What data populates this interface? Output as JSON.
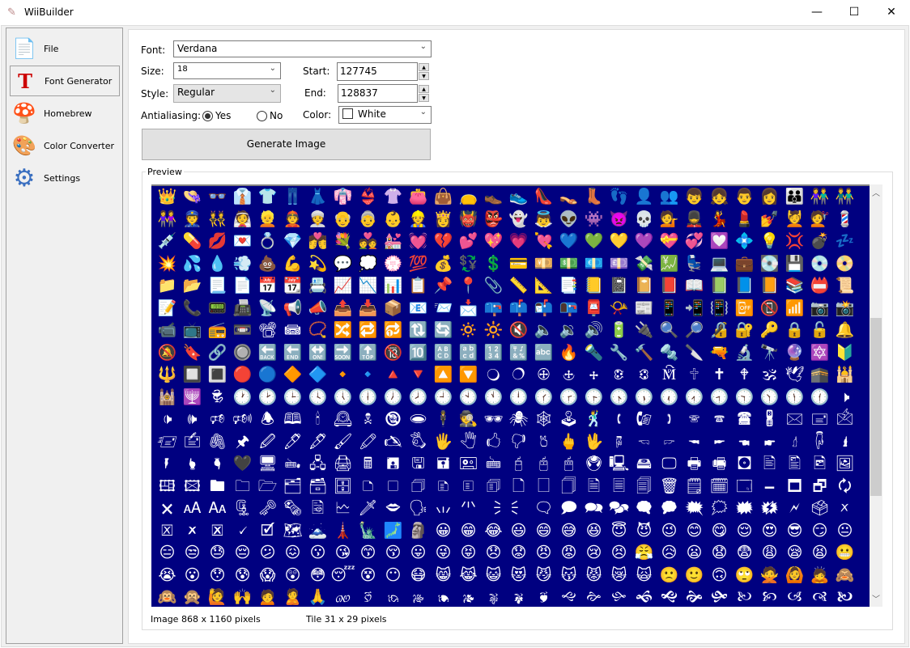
{
  "window": {
    "title": "WiiBuilder",
    "minimize": "—",
    "maximize": "☐",
    "close": "✕"
  },
  "sidebar": {
    "items": [
      {
        "label": "File",
        "icon": "📄"
      },
      {
        "label": "Font Generator",
        "icon": "T",
        "active": true
      },
      {
        "label": "Homebrew",
        "icon": "🍄"
      },
      {
        "label": "Color Converter",
        "icon": "🎨"
      },
      {
        "label": "Settings",
        "icon": "⚙"
      }
    ]
  },
  "form": {
    "font_label": "Font:",
    "font_value": "Verdana",
    "size_label": "Size:",
    "size_value": "18",
    "style_label": "Style:",
    "style_value": "Regular",
    "antialias_label": "Antialiasing:",
    "yes_label": "Yes",
    "no_label": "No",
    "antialias_selected": "Yes",
    "start_label": "Start:",
    "start_value": "127745",
    "end_label": "End:",
    "end_value": "128837",
    "color_label": "Color:",
    "color_value": "White",
    "color_swatch": "#ffffff",
    "generate_label": "Generate Image"
  },
  "preview": {
    "title": "Preview",
    "background": "#000080",
    "glyph_color": "#ffffff",
    "columns": 28,
    "scroll_rows": 12
  },
  "status": {
    "image": "Image 868 x 1160 pixels",
    "tile": "Tile 31 x 29 pixels"
  }
}
